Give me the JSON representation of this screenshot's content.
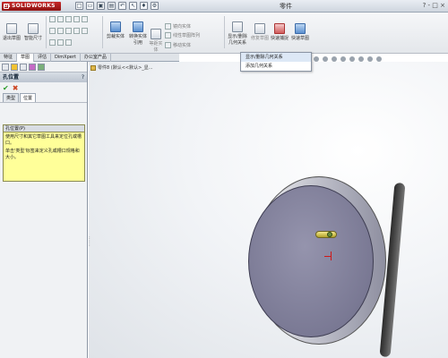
{
  "app": {
    "logo": "SOLIDWORKS",
    "window_title": "零件",
    "window_controls": "? - □ ×"
  },
  "ribbon": {
    "buttons": [
      {
        "label": "退出草图",
        "icon": "exit-sketch-icon"
      },
      {
        "label": "智能尺寸",
        "icon": "smart-dimension-icon"
      },
      {
        "label": "剪裁实体",
        "icon": "trim-icon"
      },
      {
        "label": "转换实体引用",
        "icon": "convert-entities-icon"
      },
      {
        "label": "等距实体",
        "icon": "offset-icon"
      },
      {
        "label": "显示/删除几何关系",
        "icon": "relations-icon"
      },
      {
        "label": "修复草图",
        "icon": "repair-sketch-icon"
      },
      {
        "label": "快速捕捉",
        "icon": "quick-snap-icon"
      },
      {
        "label": "快速草图",
        "icon": "rapid-sketch-icon"
      }
    ],
    "small_items": [
      "镜向实体",
      "线性草图阵列",
      "移动实体"
    ]
  },
  "tabs": [
    {
      "label": "特征",
      "active": false
    },
    {
      "label": "草图",
      "active": true
    },
    {
      "label": "评估",
      "active": false
    },
    {
      "label": "DimXpert",
      "active": false
    },
    {
      "label": "办公室产品",
      "active": false
    }
  ],
  "dropdown": {
    "items": [
      "显示/删除几何关系",
      "添加几何关系"
    ]
  },
  "panel": {
    "title": "孔位置",
    "help": "?",
    "ok": "✔",
    "cancel": "✖",
    "subtabs": [
      {
        "label": "类型",
        "active": false
      },
      {
        "label": "位置",
        "active": true
      }
    ],
    "message_title": "孔位置(P)",
    "message_lines": [
      "使用尺寸和其它草图工具来定位孔或槽口。",
      "单击'类型'标签来定义孔或槽口规格和大小。"
    ]
  },
  "viewport": {
    "tree_label": "零件8 (默认<<默认>_显..."
  },
  "colors": {
    "accent_red": "#c62828",
    "disk_face": "#7a7994",
    "hole_yellow": "#e8dc6a",
    "message_bg": "#ffff99"
  }
}
